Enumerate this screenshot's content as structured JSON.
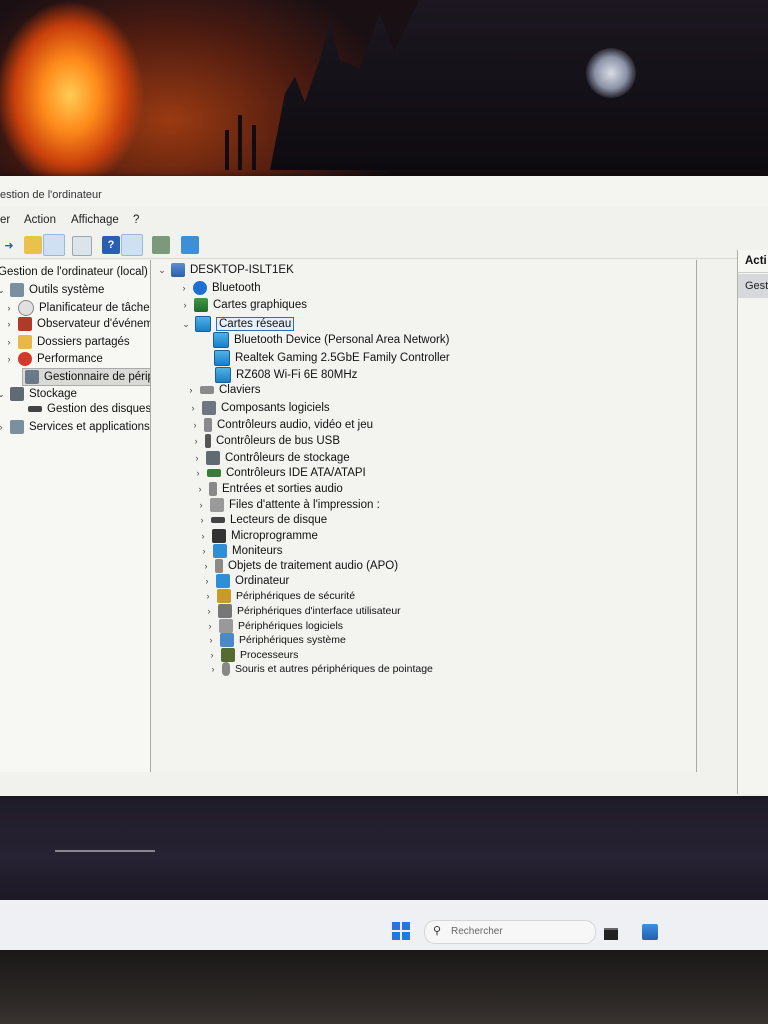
{
  "window": {
    "title": "estion de l'ordinateur",
    "menu": [
      "er",
      "Action",
      "Affichage",
      "?"
    ]
  },
  "left_tree": [
    {
      "label": "Gestion de l'ordinateur (local)",
      "chev": "",
      "icon": "computer-management-icon",
      "cls": "comp"
    },
    {
      "label": "Outils système",
      "chev": "⌄",
      "icon": "tools-icon",
      "cls": "tools"
    },
    {
      "label": "Planificateur de tâches",
      "chev": "›",
      "icon": "clock-icon",
      "cls": "clock"
    },
    {
      "label": "Observateur d'événeme",
      "chev": "›",
      "icon": "event-viewer-icon",
      "cls": "event"
    },
    {
      "label": "Dossiers partagés",
      "chev": "›",
      "icon": "shared-folder-icon",
      "cls": "folder"
    },
    {
      "label": "Performance",
      "chev": "›",
      "icon": "performance-icon",
      "cls": "perf"
    },
    {
      "label": "Gestionnaire de périphé",
      "chev": "",
      "icon": "device-manager-icon",
      "cls": "devmgr"
    },
    {
      "label": "Stockage",
      "chev": "⌄",
      "icon": "storage-icon",
      "cls": "stor"
    },
    {
      "label": "Gestion des disques",
      "chev": "",
      "icon": "disk-management-icon",
      "cls": "disk"
    },
    {
      "label": "Services et applications",
      "chev": "›",
      "icon": "services-icon",
      "cls": "tools"
    }
  ],
  "device_tree": {
    "root": "DESKTOP-ISLT1EK",
    "items": [
      {
        "label": "Bluetooth",
        "chev": "›",
        "icon": "bluetooth-icon",
        "cls": "bt",
        "level": 1
      },
      {
        "label": "Cartes graphiques",
        "chev": "›",
        "icon": "display-adapter-icon",
        "cls": "gpu",
        "level": 1
      },
      {
        "label": "Cartes réseau",
        "chev": "⌄",
        "icon": "network-adapter-icon",
        "cls": "net",
        "level": 1,
        "selected": true
      },
      {
        "label": "Bluetooth Device (Personal Area Network)",
        "chev": "",
        "icon": "network-device-icon",
        "cls": "net",
        "level": 2
      },
      {
        "label": "Realtek Gaming 2.5GbE Family Controller",
        "chev": "",
        "icon": "network-device-icon",
        "cls": "net",
        "level": 2
      },
      {
        "label": "RZ608 Wi-Fi 6E 80MHz",
        "chev": "",
        "icon": "network-device-icon",
        "cls": "net",
        "level": 2
      },
      {
        "label": "Claviers",
        "chev": "›",
        "icon": "keyboard-icon",
        "cls": "kbd",
        "level": 1
      },
      {
        "label": "Composants logiciels",
        "chev": "›",
        "icon": "software-component-icon",
        "cls": "gen",
        "level": 1
      },
      {
        "label": "Contrôleurs audio, vidéo et jeu",
        "chev": "›",
        "icon": "audio-controller-icon",
        "cls": "audio",
        "level": 1
      },
      {
        "label": "Contrôleurs de bus USB",
        "chev": "›",
        "icon": "usb-icon",
        "cls": "usb",
        "level": 1
      },
      {
        "label": "Contrôleurs de stockage",
        "chev": "›",
        "icon": "storage-controller-icon",
        "cls": "stor",
        "level": 1
      },
      {
        "label": "Contrôleurs IDE ATA/ATAPI",
        "chev": "›",
        "icon": "ide-controller-icon",
        "cls": "ide",
        "level": 1
      },
      {
        "label": "Entrées et sorties audio",
        "chev": "›",
        "icon": "audio-io-icon",
        "cls": "audio",
        "level": 1
      },
      {
        "label": "Files d'attente à l'impression :",
        "chev": "›",
        "icon": "printer-icon",
        "cls": "print",
        "level": 1
      },
      {
        "label": "Lecteurs de disque",
        "chev": "›",
        "icon": "disk-drive-icon",
        "cls": "disk",
        "level": 1
      },
      {
        "label": "Microprogramme",
        "chev": "›",
        "icon": "firmware-icon",
        "cls": "chip",
        "level": 1
      },
      {
        "label": "Moniteurs",
        "chev": "›",
        "icon": "monitor-icon",
        "cls": "mon",
        "level": 1
      },
      {
        "label": "Objets de traitement audio (APO)",
        "chev": "›",
        "icon": "audio-processing-icon",
        "cls": "audio",
        "level": 1
      },
      {
        "label": "Ordinateur",
        "chev": "›",
        "icon": "computer-icon",
        "cls": "mon",
        "level": 1
      },
      {
        "label": "Périphériques de sécurité",
        "chev": "›",
        "icon": "security-device-icon",
        "cls": "sec",
        "level": 1
      },
      {
        "label": "Périphériques d'interface utilisateur",
        "chev": "›",
        "icon": "hid-icon",
        "cls": "hid",
        "level": 1
      },
      {
        "label": "Périphériques logiciels",
        "chev": "›",
        "icon": "software-device-icon",
        "cls": "soft",
        "level": 1
      },
      {
        "label": "Périphériques système",
        "chev": "›",
        "icon": "system-device-icon",
        "cls": "sys",
        "level": 1
      },
      {
        "label": "Processeurs",
        "chev": "›",
        "icon": "processor-icon",
        "cls": "cpu",
        "level": 1
      },
      {
        "label": "Souris et autres périphériques de pointage",
        "chev": "›",
        "icon": "mouse-icon",
        "cls": "mouse",
        "level": 1
      }
    ]
  },
  "actions": {
    "header": "Acti",
    "item": "Gest"
  },
  "taskbar": {
    "search_placeholder": "Rechercher"
  }
}
